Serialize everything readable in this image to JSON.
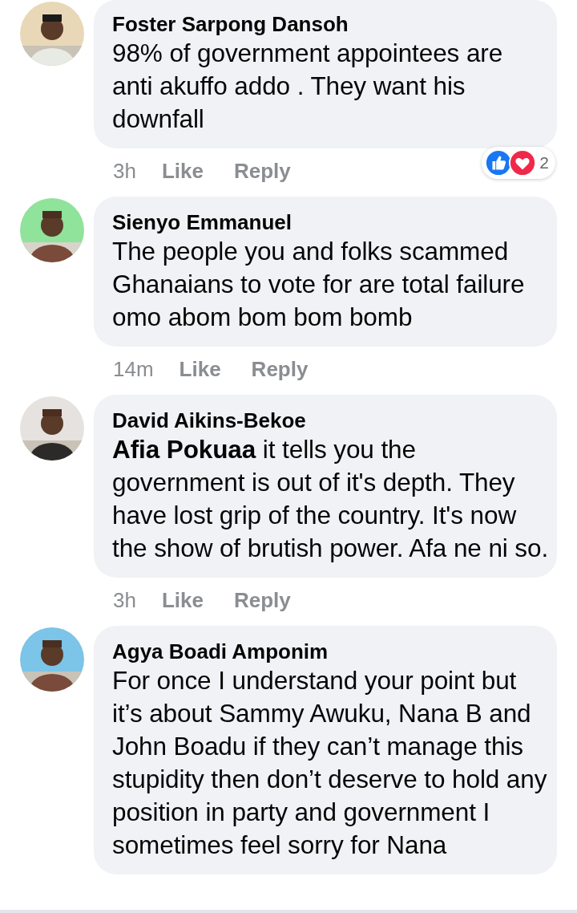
{
  "comments": [
    {
      "name": "Foster Sarpong Dansoh",
      "text": "98% of government appointees are anti akuffo addo . They want his downfall",
      "time": "3h",
      "actions": [
        "Like",
        "Reply"
      ],
      "reactions": [
        {
          "kind": "like"
        },
        {
          "kind": "love"
        }
      ],
      "reaction_count": "2"
    },
    {
      "name": "Sienyo Emmanuel",
      "text": "The people you and folks scammed Ghanaians to vote for are total failure omo abom bom bom bomb",
      "time": "14m",
      "actions": [
        "Like",
        "Reply"
      ]
    },
    {
      "name": "David Aikins-Bekoe",
      "text": "**Afia Pokuaa** it tells you the government is out of it's depth. They have lost grip of the country. It's now the show of brutish power. Afa ne ni so.",
      "time": "3h",
      "actions": [
        "Like",
        "Reply"
      ]
    },
    {
      "name": "Agya Boadi Amponim",
      "text": "For once I understand your point but it’s about Sammy Awuku, Nana B and John Boadu if they can’t manage this stupidity then don’t deserve to hold any position in party and government I sometimes feel sorry for Nana"
    }
  ]
}
